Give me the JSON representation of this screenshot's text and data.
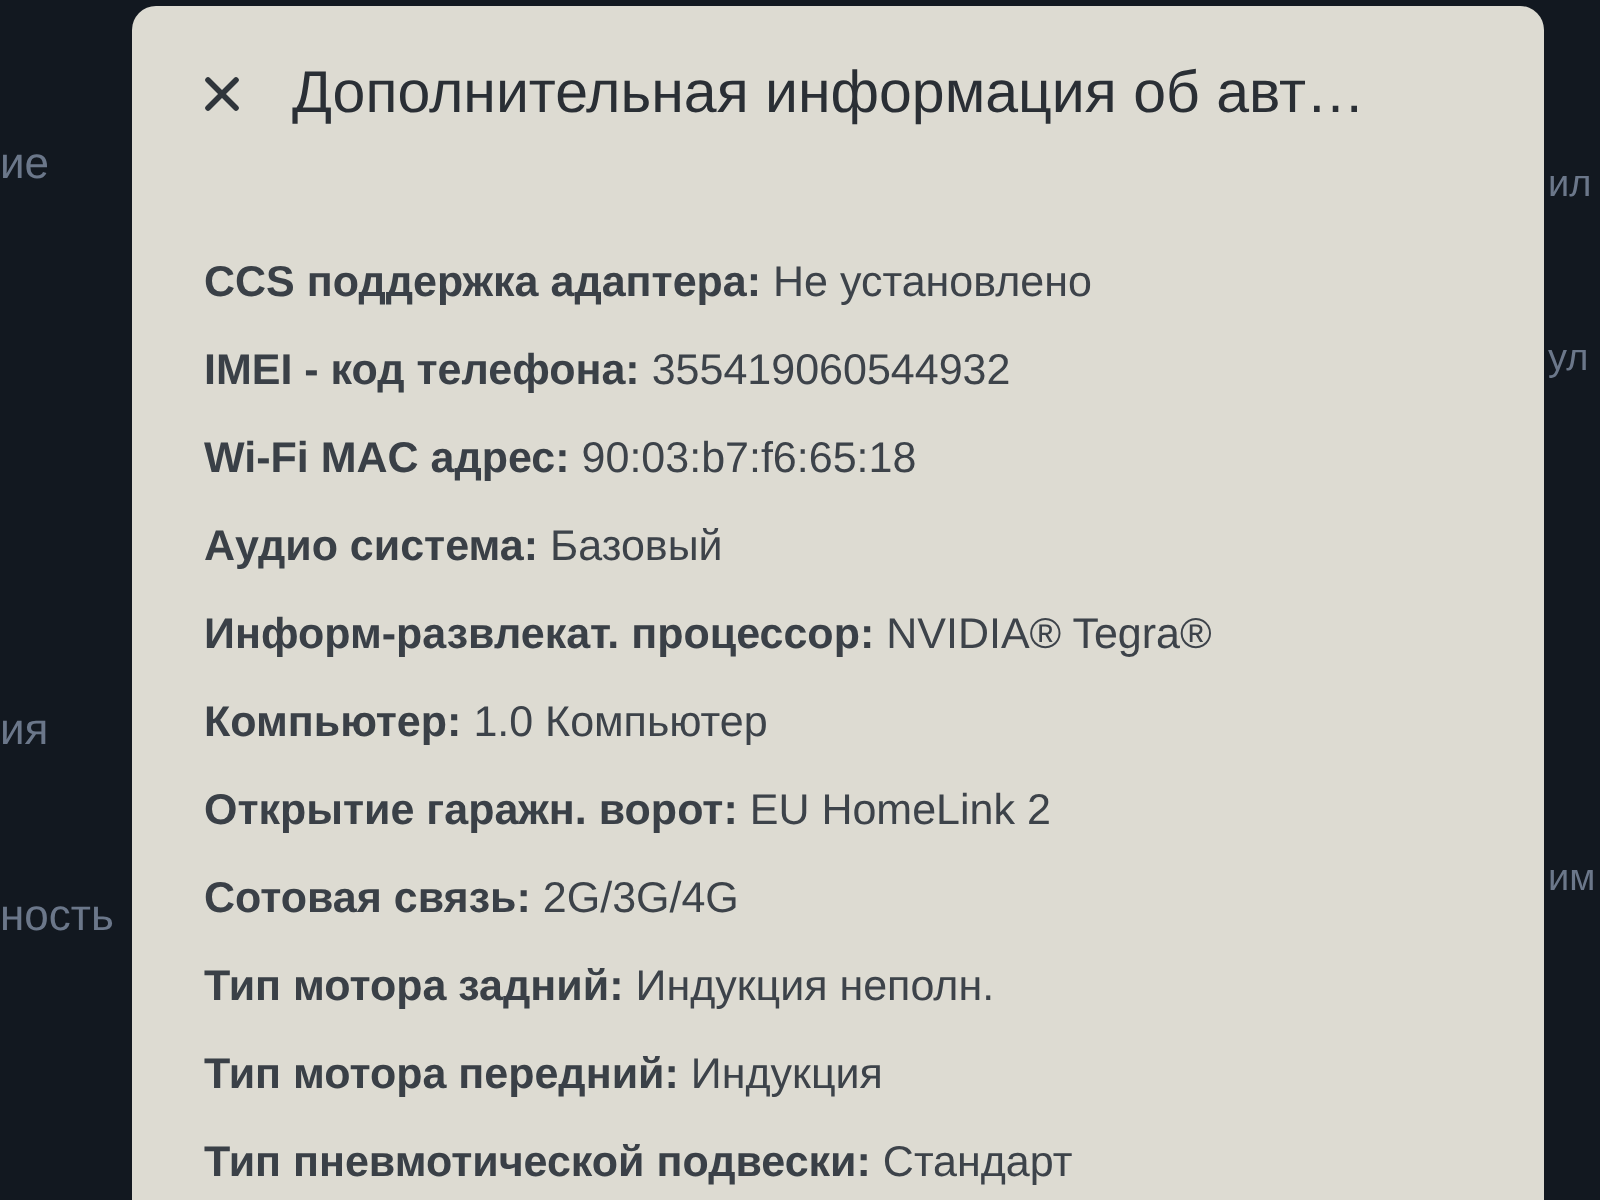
{
  "background": {
    "left_fragments": [
      "ие",
      "ия",
      "ность"
    ],
    "right_fragments": [
      "ил",
      "ул",
      "им"
    ]
  },
  "dialog": {
    "title": "Дополнительная информация об авт…",
    "rows": [
      {
        "label": "CCS поддержка адаптера:",
        "value": "Не установлено"
      },
      {
        "label": "IMEI - код телефона:",
        "value": "355419060544932"
      },
      {
        "label": "Wi-Fi MAC адрес:",
        "value": "90:03:b7:f6:65:18"
      },
      {
        "label": "Аудио система:",
        "value": "Базовый"
      },
      {
        "label": "Информ-развлекат. процессор:",
        "value": "NVIDIA® Tegra®"
      },
      {
        "label": "Компьютер:",
        "value": "1.0 Компьютер"
      },
      {
        "label": "Открытие гаражн. ворот:",
        "value": "EU HomeLink 2"
      },
      {
        "label": "Сотовая связь:",
        "value": "2G/3G/4G"
      },
      {
        "label": "Тип мотора задний:",
        "value": "Индукция неполн."
      },
      {
        "label": "Тип мотора передний:",
        "value": "Индукция"
      },
      {
        "label": "Тип пневмотической подвески:",
        "value": "Стандарт"
      }
    ]
  }
}
